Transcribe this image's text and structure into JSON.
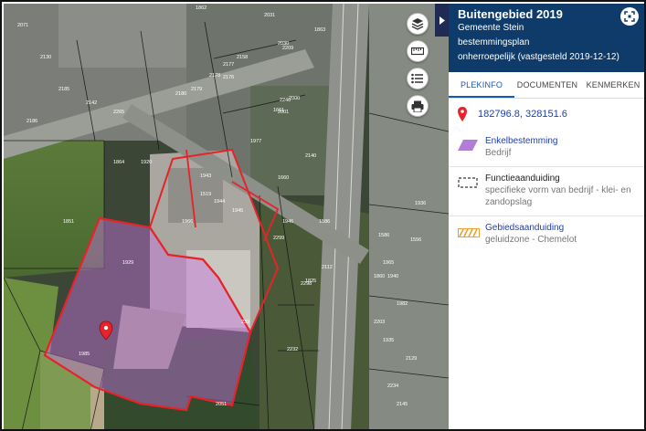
{
  "panel": {
    "title": "Buitengebied 2019",
    "municipality": "Gemeente Stein",
    "plan_type": "bestemmingsplan",
    "status": "onherroepelijk (vastgesteld 2019-12-12)",
    "tabs": [
      "PLEKINFO",
      "DOCUMENTEN",
      "KENMERKEN"
    ],
    "active_tab": "PLEKINFO",
    "coordinates": "182796.8, 328151.6",
    "items": [
      {
        "title": "Enkelbestemming",
        "desc": "Bedrijf",
        "icon": "purple-parallelogram-icon",
        "color": "#b37dd6"
      },
      {
        "title": "Functieaanduiding",
        "desc": "specifieke vorm van bedrijf - klei- en zandopslag",
        "icon": "dashed-rectangle-icon",
        "color": "#555555"
      },
      {
        "title": "Gebiedsaanduiding",
        "desc": "geluidzone - Chemelot",
        "icon": "orange-hatched-icon",
        "color": "#f0a030"
      }
    ]
  },
  "map": {
    "parcel_numbers": [
      "1862",
      "2031",
      "2030",
      "1863",
      "2158",
      "2177",
      "2178",
      "2179",
      "2180",
      "2176",
      "1966",
      "1943",
      "1944",
      "1945",
      "1586",
      "2299",
      "2298",
      "2112",
      "1825",
      "1946",
      "2240",
      "2140",
      "1660",
      "1661",
      "1864",
      "1851",
      "2001",
      "2000",
      "2209",
      "1977",
      "2071",
      "2130",
      "2185",
      "2142",
      "2186",
      "1920",
      "1519",
      "1586",
      "1965",
      "1982",
      "2203",
      "2232",
      "1936",
      "1940",
      "1935",
      "1929",
      "2129",
      "1860",
      "2234",
      "1985",
      "2051",
      "239",
      "1556",
      "2145",
      "2265"
    ],
    "plan_color": "#e8222a",
    "marker_color": "#e8222a"
  },
  "colors": {
    "header_bg": "#0e3b69",
    "accent": "#1a59b0",
    "plan_outline": "#e8222a"
  }
}
